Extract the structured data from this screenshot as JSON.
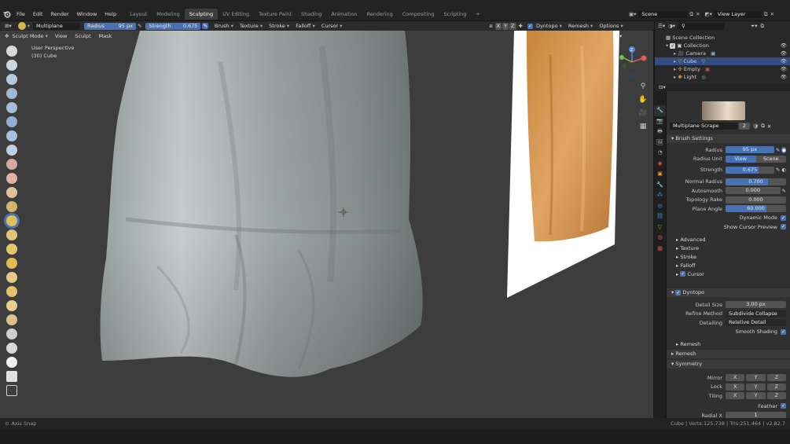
{
  "app": {
    "logo_icon": "blender-logo-icon"
  },
  "menu": [
    "File",
    "Edit",
    "Render",
    "Window",
    "Help"
  ],
  "workspaces": [
    "Layout",
    "Modeling",
    "Sculpting",
    "UV Editing",
    "Texture Paint",
    "Shading",
    "Animation",
    "Rendering",
    "Compositing",
    "Scripting"
  ],
  "active_workspace": "Sculpting",
  "add_tab": "+",
  "scene": {
    "name": "Scene",
    "view_layer": "View Layer"
  },
  "tool_header": {
    "brush_name": "Multiplane Scrape",
    "radius_label": "Radius",
    "radius_value": "95 px",
    "strength_label": "Strength",
    "strength_value": "0.675",
    "dropdowns": [
      "Brush",
      "Texture",
      "Stroke",
      "Falloff",
      "Cursor"
    ],
    "axes": [
      "X",
      "Y",
      "Z"
    ],
    "dyntopo": "Dyntopo",
    "remesh": "Remesh",
    "options": "Options"
  },
  "viewport_header": {
    "mode": "Sculpt Mode",
    "menus": [
      "View",
      "Sculpt",
      "Mask"
    ]
  },
  "viewport": {
    "view_name": "User Perspective",
    "object_info": "(30) Cube"
  },
  "outliner": {
    "root": "Scene Collection",
    "collection": "Collection",
    "items": [
      "Camera",
      "Cube",
      "Empty",
      "Light"
    ],
    "selected": "Cube"
  },
  "props": {
    "brush_name": "Multiplane Scrape",
    "brush_users": "2",
    "brush_settings": "Brush Settings",
    "radius_label": "Radius",
    "radius_value": "95 px",
    "radius_unit_label": "Radius Unit",
    "unit_view": "View",
    "unit_scene": "Scene",
    "strength_label": "Strength",
    "strength_value": "0.675",
    "strength_fraction": 0.675,
    "normal_radius_label": "Normal Radius",
    "normal_radius_value": "0.700",
    "normal_radius_fraction": 0.7,
    "autosmooth_label": "Autosmooth",
    "autosmooth_value": "0.000",
    "topology_rake_label": "Topology Rake",
    "topology_rake_value": "0.000",
    "plane_angle_label": "Plane Angle",
    "plane_angle_value": "60.000",
    "plane_angle_fraction": 0.67,
    "dynamic_mode": "Dynamic Mode",
    "show_cursor_preview": "Show Cursor Preview",
    "subpanels": [
      "Advanced",
      "Texture",
      "Stroke",
      "Falloff",
      "Cursor"
    ],
    "dyntopo": "Dyntopo",
    "detail_size_label": "Detail Size",
    "detail_size_value": "3.00 px",
    "refine_method_label": "Refine Method",
    "refine_method_value": "Subdivide Collapse",
    "detailing_label": "Detailing",
    "detailing_value": "Relative Detail",
    "smooth_shading": "Smooth Shading",
    "remesh_sub": "Remesh",
    "remesh": "Remesh",
    "symmetry": "Symmetry",
    "mirror_label": "Mirror",
    "lock_label": "Lock",
    "tiling_label": "Tiling",
    "feather": "Feather",
    "radial_x_label": "Radial X",
    "radial_x_value": "1"
  },
  "status": {
    "left": "Axis Snap",
    "right": "Cube | Verts:125,738 | Tris:251,464 | v2.82.7"
  },
  "colors": {
    "accent": "#4772b3",
    "selected_row": "#334d80",
    "viewport_bg": "#3d3d3d"
  }
}
